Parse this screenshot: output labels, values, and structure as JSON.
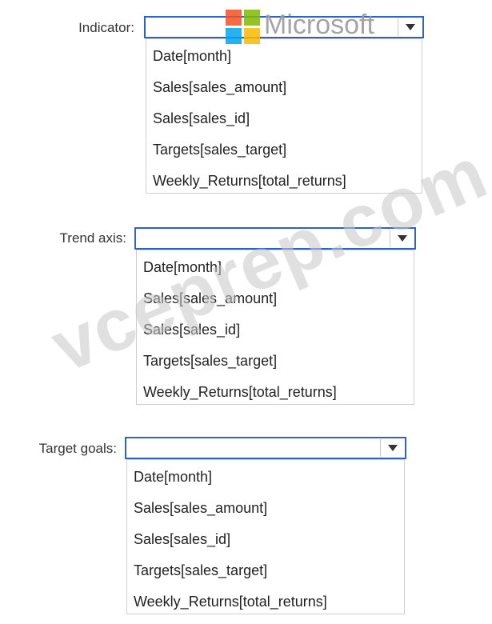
{
  "indicator": {
    "label": "Indicator:",
    "options": [
      "Date[month]",
      "Sales[sales_amount]",
      "Sales[sales_id]",
      "Targets[sales_target]",
      "Weekly_Returns[total_returns]"
    ]
  },
  "trend_axis": {
    "label": "Trend axis:",
    "options": [
      "Date[month]",
      "Sales[sales_amount]",
      "Sales[sales_id]",
      "Targets[sales_target]",
      "Weekly_Returns[total_returns]"
    ]
  },
  "target_goals": {
    "label": "Target goals:",
    "options": [
      "Date[month]",
      "Sales[sales_amount]",
      "Sales[sales_id]",
      "Targets[sales_target]",
      "Weekly_Returns[total_returns]"
    ]
  },
  "branding": {
    "logo_text": "Microsoft",
    "watermark_text": "vceprep.com",
    "colors": {
      "red": "#f25022",
      "green": "#7fba00",
      "blue": "#00a4ef",
      "yellow": "#ffb900",
      "border_accent": "#2b63c8"
    }
  }
}
